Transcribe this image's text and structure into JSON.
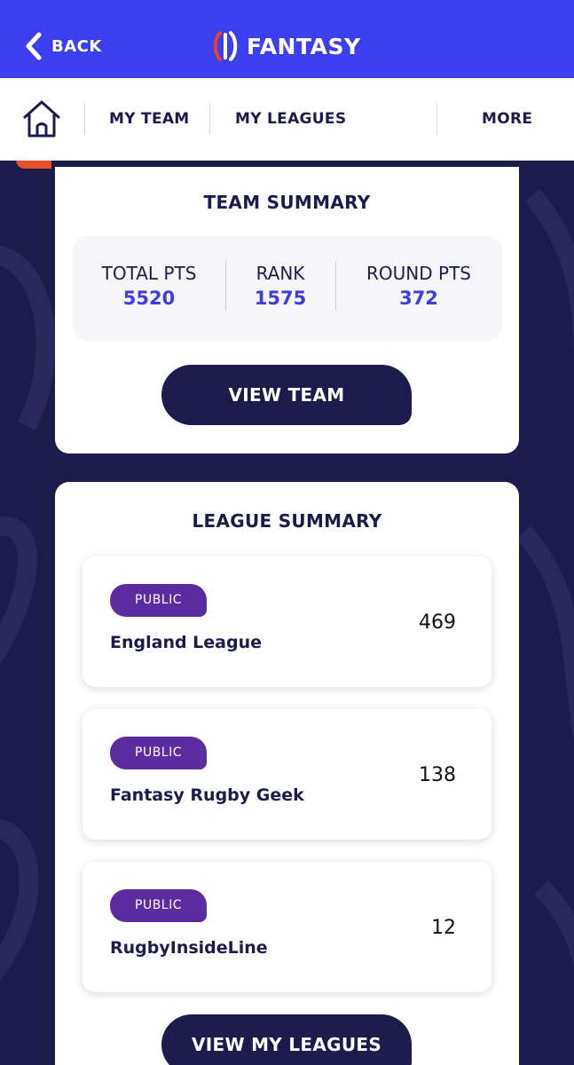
{
  "header": {
    "back_label": "BACK",
    "title": "FANTASY",
    "color": "#3b3ff0"
  },
  "nav": {
    "home_icon": "home-icon",
    "items": [
      {
        "label": "MY TEAM"
      },
      {
        "label": "MY LEAGUES"
      },
      {
        "label": "MORE"
      }
    ]
  },
  "team_summary": {
    "title": "TEAM SUMMARY",
    "stats": [
      {
        "label": "TOTAL PTS",
        "value": "5520"
      },
      {
        "label": "RANK",
        "value": "1575"
      },
      {
        "label": "ROUND PTS",
        "value": "372"
      }
    ],
    "button_label": "VIEW TEAM"
  },
  "league_summary": {
    "title": "LEAGUE SUMMARY",
    "leagues": [
      {
        "badge": "PUBLIC",
        "name": "England League",
        "points": "469"
      },
      {
        "badge": "PUBLIC",
        "name": "Fantasy Rugby Geek",
        "points": "138"
      },
      {
        "badge": "PUBLIC",
        "name": "RugbyInsideLine",
        "points": "12"
      }
    ],
    "button_label": "VIEW MY LEAGUES"
  },
  "colors": {
    "navy": "#1c1c4c",
    "accent_blue": "#3d3ee0",
    "badge_purple": "#5a2ca0"
  }
}
